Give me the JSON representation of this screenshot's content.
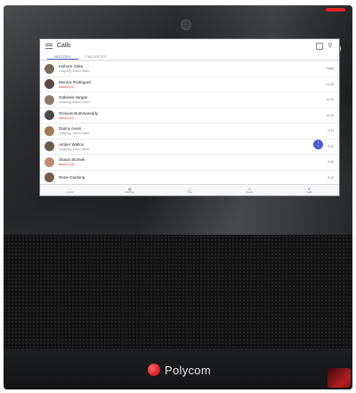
{
  "app": {
    "title": "Calls",
    "tabs": [
      {
        "label": "HISTORY",
        "active": true
      },
      {
        "label": "FAVORITES",
        "active": false
      }
    ]
  },
  "header_icons": [
    "dialpad-icon",
    "search-icon"
  ],
  "calls": [
    {
      "name": "Kishore Gaku",
      "detail": "Outgoing, 10min 30sec",
      "time": "Today",
      "status": "outgoing",
      "avatar_color": "#7a6a5c"
    },
    {
      "name": "Monica Rodriguez",
      "detail": "Missed (x1)",
      "time": "11:05",
      "status": "missed",
      "avatar_color": "#5a4a44"
    },
    {
      "name": "Gabriela Vargas",
      "detail": "Incoming, 15min 10sec",
      "time": "10:40",
      "status": "incoming",
      "avatar_color": "#8b7a6a"
    },
    {
      "name": "Srinivas Bommareddy",
      "detail": "Missed (x1)",
      "time": "10:15",
      "status": "missed",
      "avatar_color": "#4a4a4a"
    },
    {
      "name": "Danny Avani",
      "detail": "Outgoing, 10min 15sec",
      "time": "9:31",
      "status": "outgoing",
      "avatar_color": "#a07a55"
    },
    {
      "name": "Amber Walton",
      "detail": "Outgoing, 10min 45sec",
      "time": "9:20",
      "status": "outgoing",
      "avatar_color": "#6a5a4a"
    },
    {
      "name": "Shauri Slomek",
      "detail": "Missed (x1)",
      "time": "8:50",
      "status": "missed",
      "avatar_color": "#c08a70"
    },
    {
      "name": "Rene Cardona",
      "detail": "",
      "time": "8:10",
      "status": "outgoing",
      "avatar_color": "#7a5a4a"
    }
  ],
  "bottom_nav": [
    {
      "label": "Activity",
      "icon": "activity-icon",
      "active": false
    },
    {
      "label": "Meetings",
      "icon": "calendar-icon",
      "active": false
    },
    {
      "label": "Chat",
      "icon": "chat-icon",
      "active": false
    },
    {
      "label": "People",
      "icon": "people-icon",
      "active": false
    },
    {
      "label": "Calls",
      "icon": "phone-icon",
      "active": true
    }
  ],
  "side_controls": {
    "top": "⊘",
    "volume_up": "+",
    "volume_down": "−"
  },
  "brand": {
    "name": "Polycom"
  },
  "colors": {
    "accent": "#4a5bd0",
    "missed": "#d93a3a",
    "brand_red": "#d8262b"
  }
}
